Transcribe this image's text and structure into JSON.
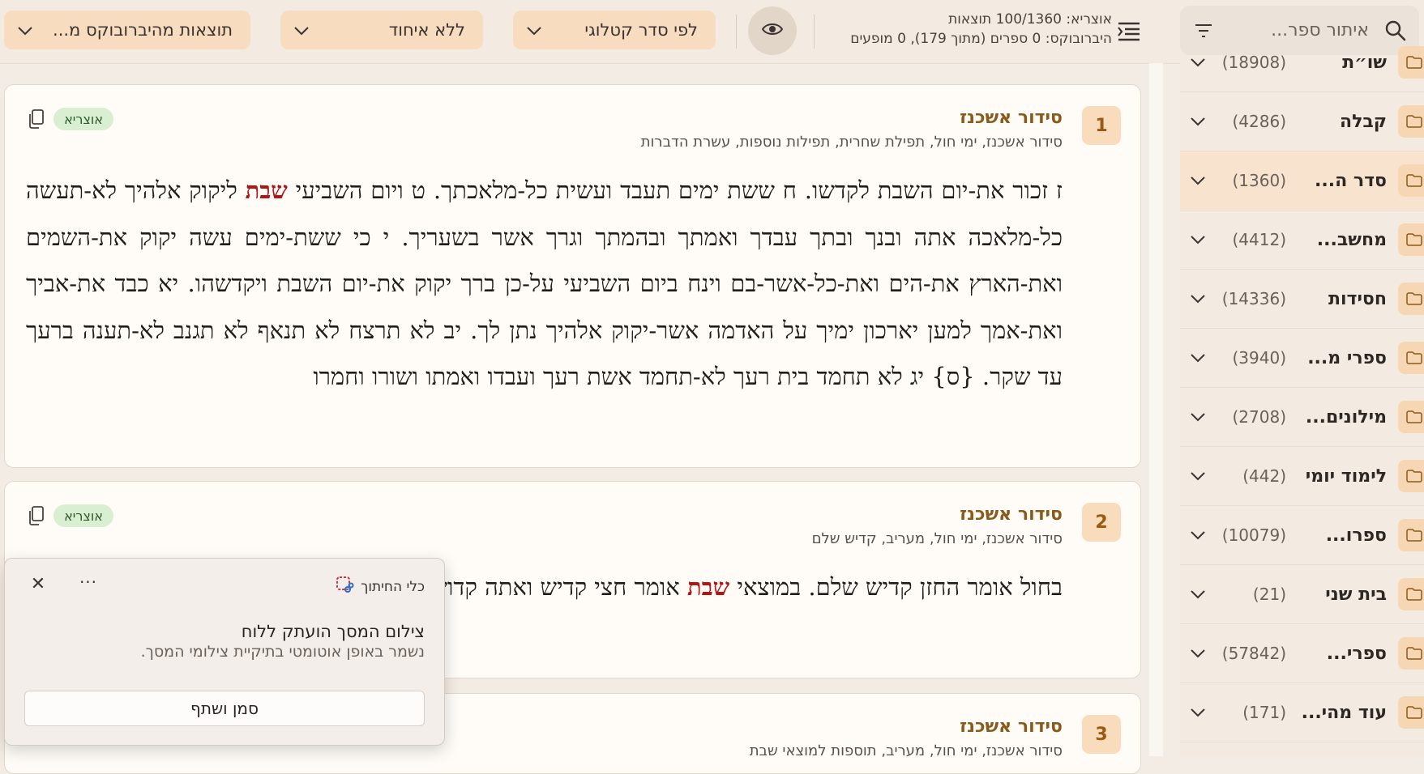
{
  "header": {
    "search_placeholder": "איתור ספר...",
    "results_line1": "אוצריא: 100/1360 תוצאות",
    "results_line2": "היברובוקס: 0 ספרים (מתוך 179), 0 מופעים",
    "sort_label": "לפי סדר קטלוגי",
    "group_label": "ללא איחוד",
    "filter_label": "תוצאות מהיברובוקס מ..."
  },
  "sidebar": {
    "items": [
      {
        "name": "שו״ת",
        "count": "(18908)"
      },
      {
        "name": "קבלה",
        "count": "(4286)"
      },
      {
        "name": "סדר ה...",
        "count": "(1360)"
      },
      {
        "name": "מחשב...",
        "count": "(4412)"
      },
      {
        "name": "חסידות",
        "count": "(14336)"
      },
      {
        "name": "ספרי מ...",
        "count": "(3940)"
      },
      {
        "name": "מילונים...",
        "count": "(2708)"
      },
      {
        "name": "לימוד יומי",
        "count": "(442)"
      },
      {
        "name": "ספרו...",
        "count": "(10079)"
      },
      {
        "name": "בית שני",
        "count": "(21)"
      },
      {
        "name": "ספרי...",
        "count": "(57842)"
      },
      {
        "name": "עוד מהי...",
        "count": "(171)"
      }
    ]
  },
  "results": [
    {
      "number": "1",
      "title": "סידור אשכנז",
      "path": "סידור אשכנז, ימי חול, תפילת שחרית, תפילות נוספות, עשרת הדברות",
      "badge": "אוצריא",
      "text_before": "ז זכור את-יום השבת לקדשו. ח ששת ימים תעבד ועשית כל-מלאכתך. ט ויום השביעי ",
      "highlight": "שבת",
      "text_after": " ליקוק אלהיך לא-תעשה כל-מלאכה אתה ובנך ובתך עבדך ואמתך ובהמתך וגרך אשר בשעריך. י כי ששת-ימים עשה יקוק את-השמים ואת-הארץ את-הים ואת-כל-אשר-בם וינח ביום השביעי על-כן ברך יקוק את-יום השבת ויקדשהו. יא כבד את-אביך ואת-אמך למען יארכון ימיך על האדמה אשר-יקוק אלהיך נתן לך. יב לא תרצח לא תנאף לא תגנב לא-תענה ברעך עד שקר. {ס} יג לא תחמד בית רעך לא-תחמד אשת רעך ועבדו ואמתו ושורו וחמרו"
    },
    {
      "number": "2",
      "title": "סידור אשכנז",
      "path": "סידור אשכנז, ימי חול, מעריב, קדיש שלם",
      "badge": "אוצריא",
      "text_before": "בחול אומר החזן קדיש שלם. במוצאי ",
      "highlight": "שבת",
      "text_after": " אומר חצי קדיש ואתה קדוש"
    },
    {
      "number": "3",
      "title": "סידור אשכנז",
      "path": "סידור אשכנז, ימי חול, מעריב, תוספות למוצאי שבת"
    }
  ],
  "popup": {
    "title": "כלי החיתוך",
    "message": "צילום המסך הועתק ללוח",
    "sub": "נשמר באופן אוטומטי בתיקיית צילומי המסך.",
    "button": "סמן ושתף",
    "close": "✕",
    "more": "···"
  }
}
